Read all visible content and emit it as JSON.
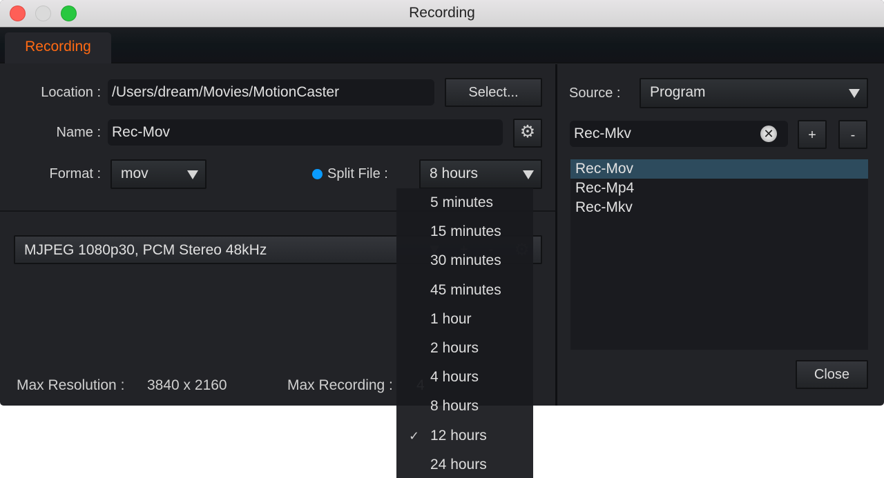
{
  "window": {
    "title": "Recording",
    "controls": [
      "close",
      "minimize",
      "zoom"
    ]
  },
  "tabs": [
    {
      "label": "Recording",
      "active": true
    }
  ],
  "accent_color": "#ff6a13",
  "form": {
    "location": {
      "label": "Location :",
      "value": "/Users/dream/Movies/MotionCaster",
      "button": "Select..."
    },
    "name": {
      "label": "Name :",
      "value": "Rec-Mov",
      "settings_icon": "gear-icon"
    },
    "format": {
      "label": "Format :",
      "value": "mov"
    },
    "split_file": {
      "label": "Split File :",
      "value": "8 hours",
      "enabled": true,
      "radio_color": "#0a9bff"
    }
  },
  "preset": {
    "value": "MJPEG 1080p30, PCM Stereo 48kHz",
    "add_label": "+",
    "remove_label": "-"
  },
  "status": {
    "max_resolution_label": "Max Resolution :",
    "max_resolution_value": "3840 x 2160",
    "max_recording_label": "Max Recording :",
    "max_recording_value": "4"
  },
  "right": {
    "source_label": "Source :",
    "source_value": "Program",
    "profile_name": "Rec-Mkv",
    "add_label": "+",
    "remove_label": "-",
    "profiles": [
      {
        "label": "Rec-Mov",
        "selected": true
      },
      {
        "label": "Rec-Mp4",
        "selected": false
      },
      {
        "label": "Rec-Mkv",
        "selected": false
      }
    ],
    "selected_color": "#2d4b5d",
    "close_label": "Close"
  },
  "split_menu": {
    "options": [
      {
        "label": "5 minutes",
        "checked": false
      },
      {
        "label": "15 minutes",
        "checked": false
      },
      {
        "label": "30 minutes",
        "checked": false
      },
      {
        "label": "45 minutes",
        "checked": false
      },
      {
        "label": "1 hour",
        "checked": false
      },
      {
        "label": "2 hours",
        "checked": false
      },
      {
        "label": "4 hours",
        "checked": false
      },
      {
        "label": "8 hours",
        "checked": false
      },
      {
        "label": "12 hours",
        "checked": true
      },
      {
        "label": "24 hours",
        "checked": false
      }
    ],
    "check_glyph": "✓"
  }
}
